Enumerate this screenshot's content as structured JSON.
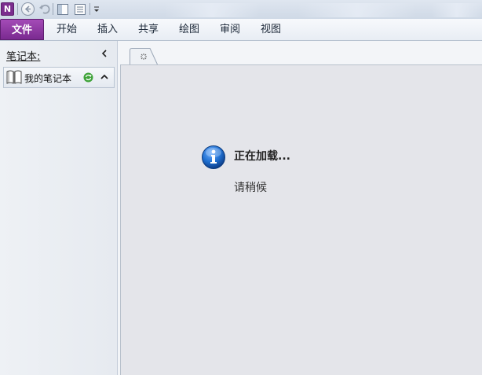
{
  "app": {
    "logo_letter": "N"
  },
  "ribbon": {
    "tabs": [
      {
        "label": "文件",
        "selected": true
      },
      {
        "label": "开始"
      },
      {
        "label": "插入"
      },
      {
        "label": "共享"
      },
      {
        "label": "绘图"
      },
      {
        "label": "审阅"
      },
      {
        "label": "视图"
      }
    ]
  },
  "nav": {
    "header_label": "笔记本:",
    "notebooks": [
      {
        "name": "我的笔记本"
      }
    ]
  },
  "status": {
    "title": "正在加载...",
    "subtitle": "请稍候"
  },
  "colors": {
    "file_tab": "#8b3aa0",
    "info_icon": "#1f6fd0",
    "sync_icon": "#3fa33a"
  },
  "icons": {
    "logo": "onenote-logo-icon",
    "back": "back-arrow-icon",
    "undo": "undo-icon",
    "dock": "dock-to-desktop-icon",
    "fullpage": "full-page-view-icon",
    "customize": "customize-dropdown-icon",
    "collapse": "collapse-chevron-left-icon",
    "notebook": "notebook-book-icon",
    "sync": "sync-icon",
    "expand": "chevron-up-icon",
    "section": "section-loading-icon",
    "info": "info-icon"
  }
}
